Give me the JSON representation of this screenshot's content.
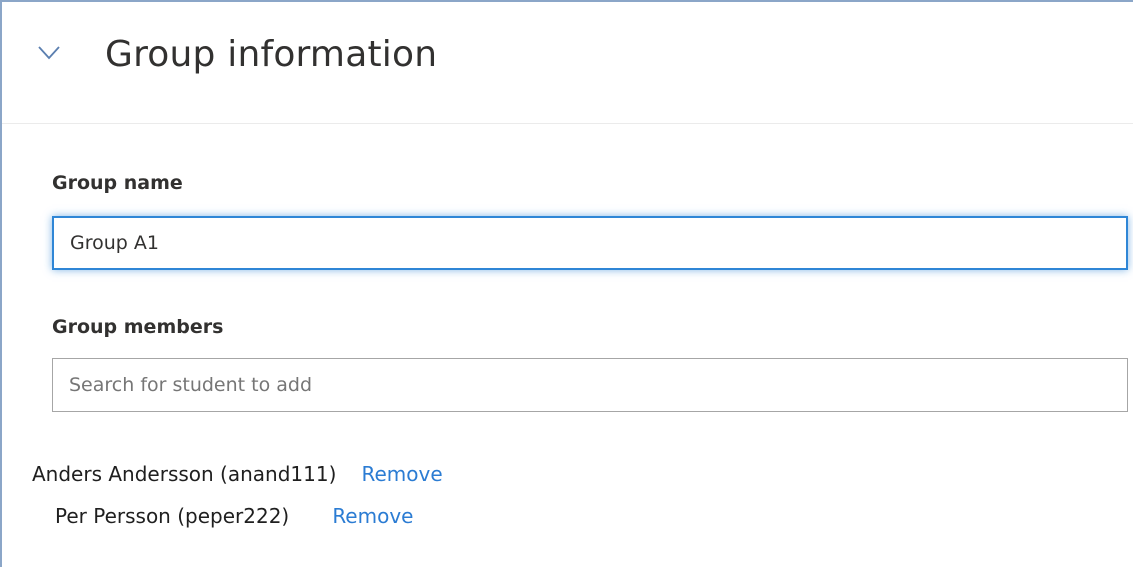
{
  "section": {
    "title": "Group information",
    "expanded": true
  },
  "group_name": {
    "label": "Group name",
    "value": "Group A1"
  },
  "group_members": {
    "label": "Group members",
    "search_placeholder": "Search for student to add",
    "members": [
      {
        "name": "Anders Andersson (anand111)",
        "remove_label": "Remove"
      },
      {
        "name": "Per Persson (peper222)",
        "remove_label": "Remove"
      }
    ]
  },
  "colors": {
    "panel_border": "#8ba6c8",
    "focus_border": "#2f86d6",
    "link": "#2b7cd3",
    "text": "#323130"
  }
}
